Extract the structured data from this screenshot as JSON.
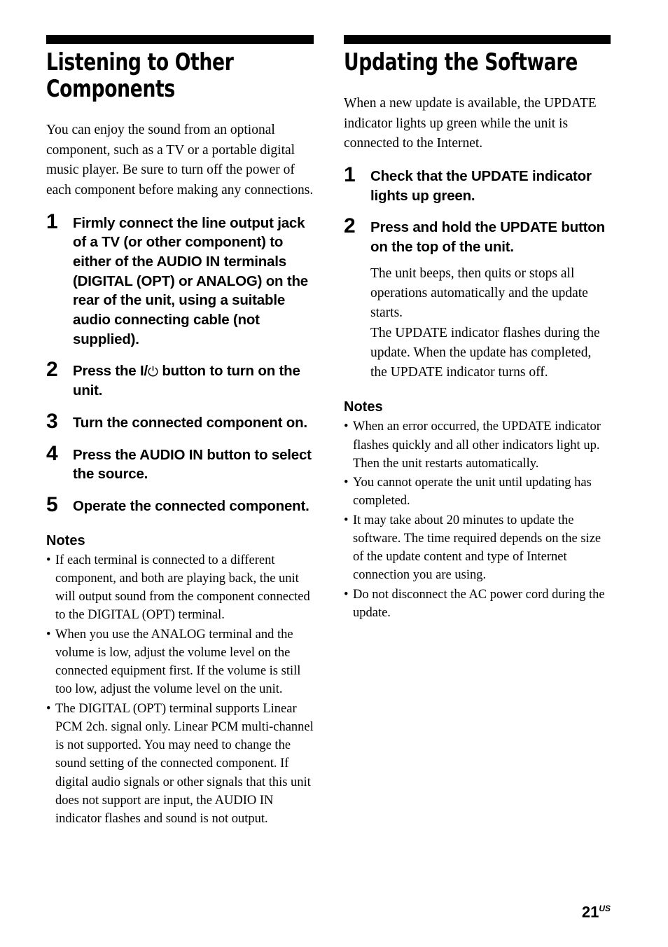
{
  "page": {
    "number": "21",
    "number_suffix": "US"
  },
  "left_column": {
    "title": "Listening to Other Components",
    "intro": "You can enjoy the sound from an optional component, such as a TV or a portable digital music player. Be sure to turn off the power of each component before making any connections.",
    "steps": [
      {
        "number": "1",
        "text": "Firmly connect the line output jack of a TV (or other component) to either of the AUDIO IN terminals (DIGITAL (OPT) or ANALOG) on the rear of the unit, using a suitable audio connecting cable (not supplied)."
      },
      {
        "number": "2",
        "text_before": "Press the I/",
        "symbol": "⏻",
        "symbol_name": "power-standby-symbol",
        "text_after": " button to turn on the unit."
      },
      {
        "number": "3",
        "text": "Turn the connected component on."
      },
      {
        "number": "4",
        "text": "Press the AUDIO IN button to select the source."
      },
      {
        "number": "5",
        "text": "Operate the connected component."
      }
    ],
    "notes_title": "Notes",
    "notes": [
      "If each terminal is connected to a different component, and both are playing back, the unit will output sound from the component connected to the DIGITAL (OPT) terminal.",
      "When you use the ANALOG terminal and the volume is low, adjust the volume level on the connected equipment first. If the volume is still too low, adjust the volume level on the unit.",
      "The DIGITAL (OPT) terminal supports Linear PCM 2ch. signal only. Linear PCM multi-channel is not supported. You may need to change the sound setting of the connected component. If digital audio signals or other signals that this unit does not support are input, the AUDIO IN indicator flashes and sound is not output."
    ],
    "bullet": "•"
  },
  "right_column": {
    "title": "Updating the Software",
    "intro": "When a new update is available, the UPDATE indicator lights up green while the unit is connected to the Internet.",
    "steps": [
      {
        "number": "1",
        "text": "Check that the UPDATE indicator lights up green.",
        "sub": []
      },
      {
        "number": "2",
        "text": "Press and hold the UPDATE button on the top of the unit.",
        "sub": [
          "The unit beeps, then quits or stops all operations automatically and the update starts.",
          "The UPDATE indicator flashes during the update. When the update has completed, the UPDATE indicator turns off."
        ]
      }
    ],
    "notes_title": "Notes",
    "notes": [
      "When an error occurred, the UPDATE indicator flashes quickly and all other indicators light up. Then the unit restarts automatically.",
      "You cannot operate the unit until updating has completed.",
      "It may take about 20 minutes to update the software. The time required depends on the size of the update content and type of Internet connection you are using.",
      "Do not disconnect the AC power cord during the update."
    ],
    "bullet": "•"
  }
}
